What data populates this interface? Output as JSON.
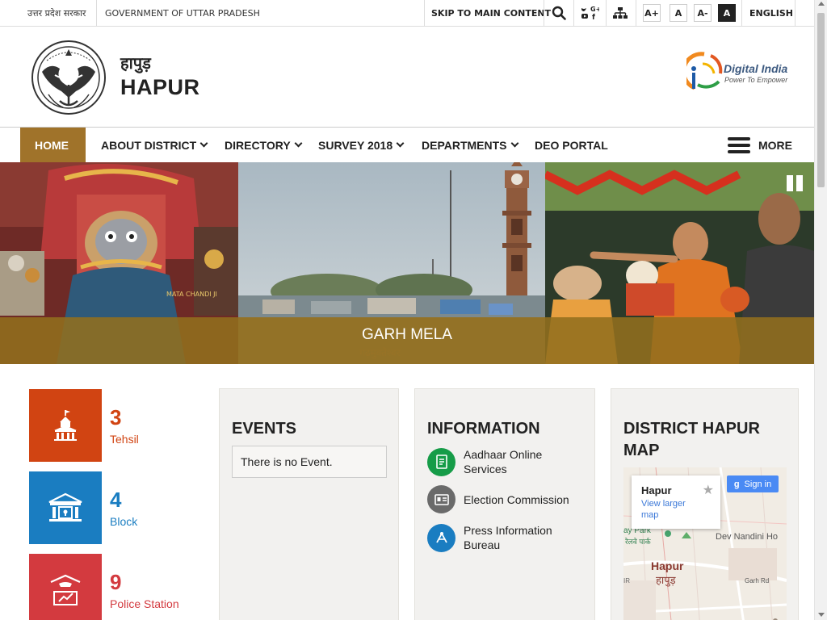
{
  "topbar": {
    "gov_hindi": "उत्तर प्रदेश सरकार",
    "gov_english": "GOVERNMENT OF UTTAR PRADESH",
    "skip": "SKIP TO MAIN CONTENT",
    "font_increase": "A+",
    "font_normal": "A",
    "font_decrease": "A-",
    "contrast": "A",
    "language": "ENGLISH"
  },
  "header": {
    "title_hindi": "हापुड़",
    "title_english": "HAPUR",
    "digital_india_title": "Digital India",
    "digital_india_tagline": "Power To Empower"
  },
  "nav": {
    "items": [
      {
        "label": "HOME",
        "dropdown": false
      },
      {
        "label": "ABOUT DISTRICT",
        "dropdown": true
      },
      {
        "label": "DIRECTORY",
        "dropdown": true
      },
      {
        "label": "SURVEY 2018",
        "dropdown": true
      },
      {
        "label": "DEPARTMENTS",
        "dropdown": true
      },
      {
        "label": "DEO PORTAL",
        "dropdown": false
      }
    ],
    "more": "MORE"
  },
  "banner": {
    "caption": "GARH MELA",
    "photo_text": "MATA CHANDI JI"
  },
  "stats": [
    {
      "number": "3",
      "label": "Tehsil",
      "color": "#d14412"
    },
    {
      "number": "4",
      "label": "Block",
      "color": "#1a7dc1"
    },
    {
      "number": "9",
      "label": "Police Station",
      "color": "#d33a3f"
    }
  ],
  "events": {
    "title": "EVENTS",
    "empty": "There is no Event."
  },
  "information": {
    "title": "INFORMATION",
    "items": [
      {
        "label": "Aadhaar Online Services",
        "color": "#169c48"
      },
      {
        "label": "Election Commission",
        "color": "#6a6a6a"
      },
      {
        "label": "Press Information Bureau",
        "color": "#1a7dc1"
      }
    ]
  },
  "map": {
    "title": "DISTRICT HAPUR MAP",
    "popup_title": "Hapur",
    "popup_link": "View larger map",
    "signin": "Sign in",
    "place_1": "Dev Nandini Ho",
    "place_2": "Hapur",
    "place_2_hindi": "हापुड़",
    "place_3": "ay Park",
    "place_3_hindi": "रेलवे पार्क",
    "place_4": "Garh Rd",
    "edge_label": "IR"
  }
}
